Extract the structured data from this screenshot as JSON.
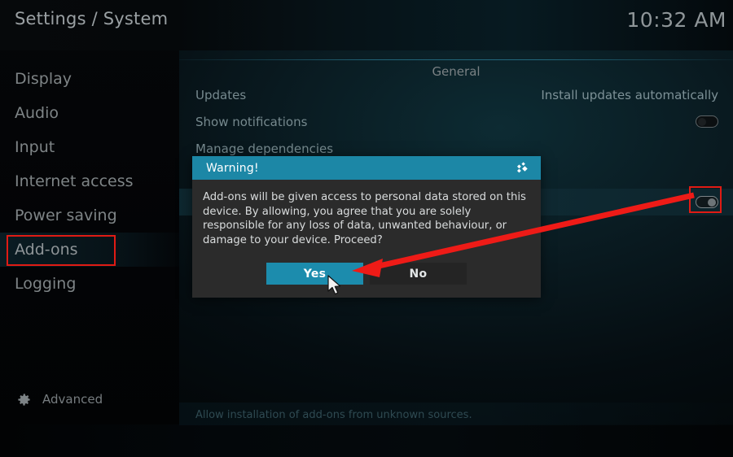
{
  "header": {
    "title": "Settings / System",
    "clock": "10:32 AM"
  },
  "sidebar": {
    "items": [
      {
        "label": "Display",
        "selected": false
      },
      {
        "label": "Audio",
        "selected": false
      },
      {
        "label": "Input",
        "selected": false
      },
      {
        "label": "Internet access",
        "selected": false
      },
      {
        "label": "Power saving",
        "selected": false
      },
      {
        "label": "Add-ons",
        "selected": true
      },
      {
        "label": "Logging",
        "selected": false
      }
    ],
    "advanced_label": "Advanced",
    "advanced_icon": "gear-icon"
  },
  "content": {
    "section_title": "General",
    "rows": [
      {
        "label": "Updates",
        "value": "Install updates automatically",
        "control": "text"
      },
      {
        "label": "Show notifications",
        "value": "",
        "control": "toggle",
        "toggle_state": "off"
      },
      {
        "label": "Manage dependencies",
        "value": "",
        "control": "none"
      },
      {
        "label": "",
        "value": "",
        "control": "toggle",
        "toggle_state": "on",
        "highlighted": true
      }
    ],
    "help_text": "Allow installation of add-ons from unknown sources."
  },
  "dialog": {
    "title": "Warning!",
    "logo_icon": "kodi-logo-icon",
    "message": "Add-ons will be given access to personal data stored on this device. By allowing, you agree that you are solely responsible for any loss of data, unwanted behaviour, or damage to your device. Proceed?",
    "buttons": [
      {
        "label": "Yes",
        "style": "primary"
      },
      {
        "label": "No",
        "style": "secondary"
      }
    ]
  },
  "annotations": {
    "highlight_color": "#e01b14",
    "arrow_color": "#ee1b17",
    "boxes": [
      {
        "target": "sidebar-item-add-ons"
      },
      {
        "target": "unknown-sources-toggle"
      }
    ],
    "arrow": {
      "from_label": "unknown-sources-toggle",
      "to_label": "dialog-yes-button"
    }
  },
  "colors": {
    "accent_teal": "#1c8cad",
    "dialog_bg": "#2b2b2b",
    "app_bg": "#04080a"
  }
}
